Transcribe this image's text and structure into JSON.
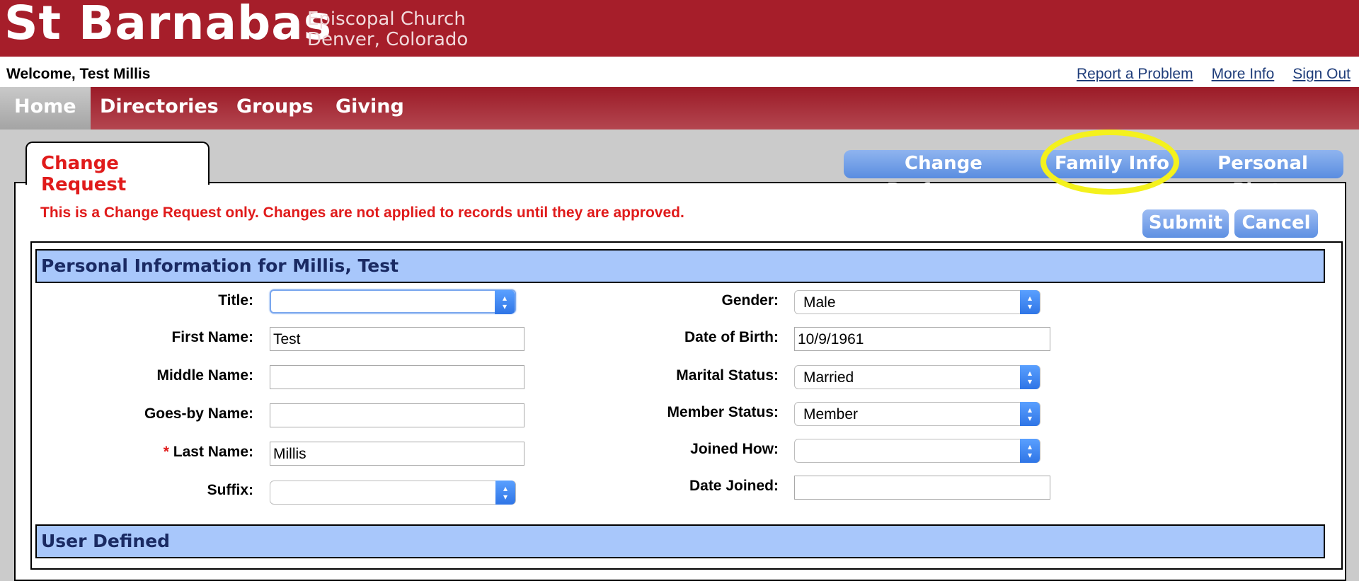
{
  "header": {
    "church_name": "St Barnabas",
    "church_line1": "Episcopal Church",
    "church_line2": "Denver, Colorado",
    "welcome": "Welcome, Test Millis",
    "links": [
      "Report a Problem",
      "More Info",
      "Sign Out"
    ]
  },
  "nav": {
    "items": [
      "Home",
      "Directories",
      "Groups",
      "Giving"
    ],
    "active": "Home"
  },
  "tabs": {
    "current": "Change Request",
    "others": [
      "Change Preference",
      "Family Info",
      "Personal Photo"
    ],
    "highlighted": "Family Info"
  },
  "notice": "This is a Change Request only. Changes are not applied to records until they are approved.",
  "actions": {
    "submit": "Submit",
    "cancel": "Cancel"
  },
  "sections": {
    "personal_title": "Personal Information for Millis, Test",
    "user_defined_title": "User Defined"
  },
  "form": {
    "title": {
      "label": "Title:",
      "value": ""
    },
    "first_name": {
      "label": "First Name:",
      "value": "Test"
    },
    "middle_name": {
      "label": "Middle Name:",
      "value": ""
    },
    "goes_by_name": {
      "label": "Goes-by Name:",
      "value": ""
    },
    "last_name": {
      "label": "Last Name:",
      "required_mark": "*",
      "value": "Millis"
    },
    "suffix": {
      "label": "Suffix:",
      "value": ""
    },
    "gender": {
      "label": "Gender:",
      "value": "Male"
    },
    "date_of_birth": {
      "label": "Date of Birth:",
      "value": "10/9/1961"
    },
    "marital_status": {
      "label": "Marital Status:",
      "value": "Married"
    },
    "member_status": {
      "label": "Member Status:",
      "value": "Member"
    },
    "joined_how": {
      "label": "Joined How:",
      "value": ""
    },
    "date_joined": {
      "label": "Date Joined:",
      "value": ""
    }
  },
  "colors": {
    "banner": "#a61e2a",
    "accent_blue": "#5a8de0",
    "section_head": "#a8c7fb",
    "notice_red": "#e01b1b",
    "highlight": "#f4f11d"
  },
  "icons": {
    "select_arrow": "chevron-updown-icon"
  }
}
